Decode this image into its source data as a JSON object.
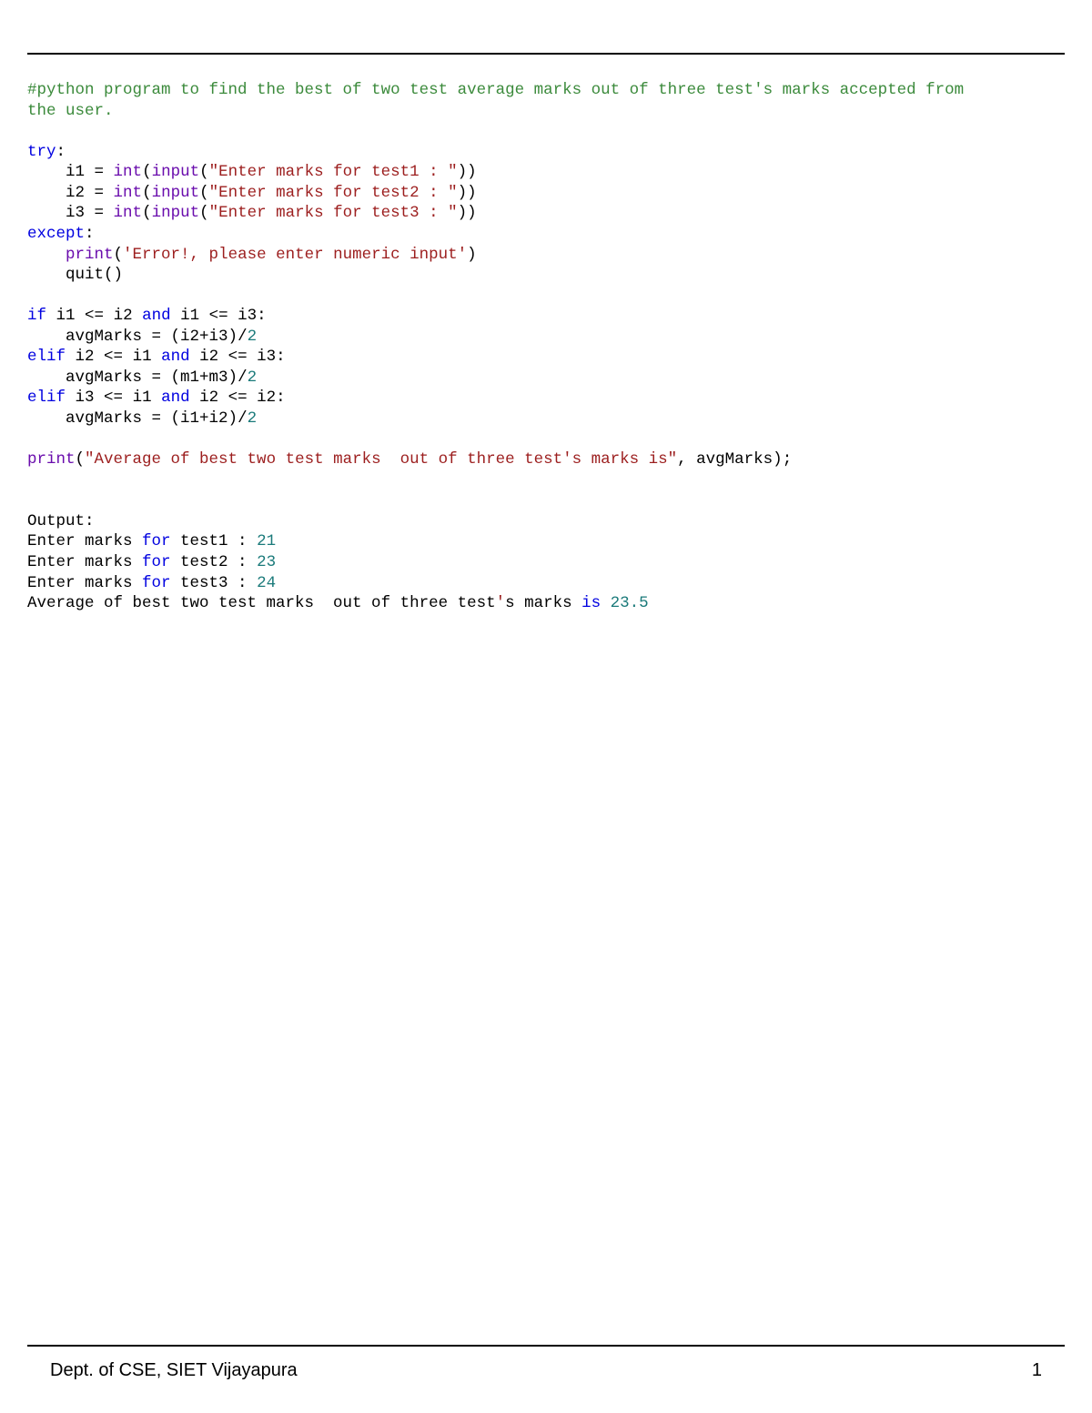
{
  "code": {
    "comment_line1": "#python program to find the best of two test average marks out of three test's marks accepted from",
    "comment_line2": "the user.",
    "kw_try": "try",
    "kw_except": "except",
    "kw_if": "if",
    "kw_elif": "elif",
    "kw_and": "and",
    "kw_for": "for",
    "kw_is": "is",
    "builtin_int": "int",
    "builtin_input": "input",
    "builtin_print": "print",
    "builtin_quit": "quit",
    "var_i1": "i1",
    "var_i2": "i2",
    "var_i3": "i3",
    "var_avgMarks": "avgMarks",
    "var_m1m3": "(m1+m3)",
    "str_test1": "\"Enter marks for test1 : \"",
    "str_test2": "\"Enter marks for test2 : \"",
    "str_test3": "\"Enter marks for test3 : \"",
    "str_error": "'Error!, please enter numeric input'",
    "str_avg": "\"Average of best two test marks  out of three test's marks is\"",
    "num_2": "2",
    "op_eq": " = ",
    "op_lte": " <= ",
    "op_colon": ":",
    "op_semicolon": ";",
    "op_open": "(",
    "op_close": ")",
    "op_dbl_close": "))",
    "op_comma": ", ",
    "expr_i2i3": "(i2+i3)",
    "expr_i1i2": "(i1+i2)",
    "op_slash": "/",
    "indent": "    "
  },
  "output": {
    "label": "Output:",
    "line1_pre": "Enter marks ",
    "line1_post": " test1 : ",
    "line1_val": "21",
    "line2_pre": "Enter marks ",
    "line2_post": " test2 : ",
    "line2_val": "23",
    "line3_pre": "Enter marks ",
    "line3_post": " test3 : ",
    "line3_val": "24",
    "line4_pre": "Average of best two test marks  out of three test",
    "line4_apos": "'",
    "line4_mid": "s marks ",
    "line4_val": "23.5"
  },
  "footer": {
    "left": "Dept. of CSE, SIET Vijayapura",
    "right": "1"
  }
}
